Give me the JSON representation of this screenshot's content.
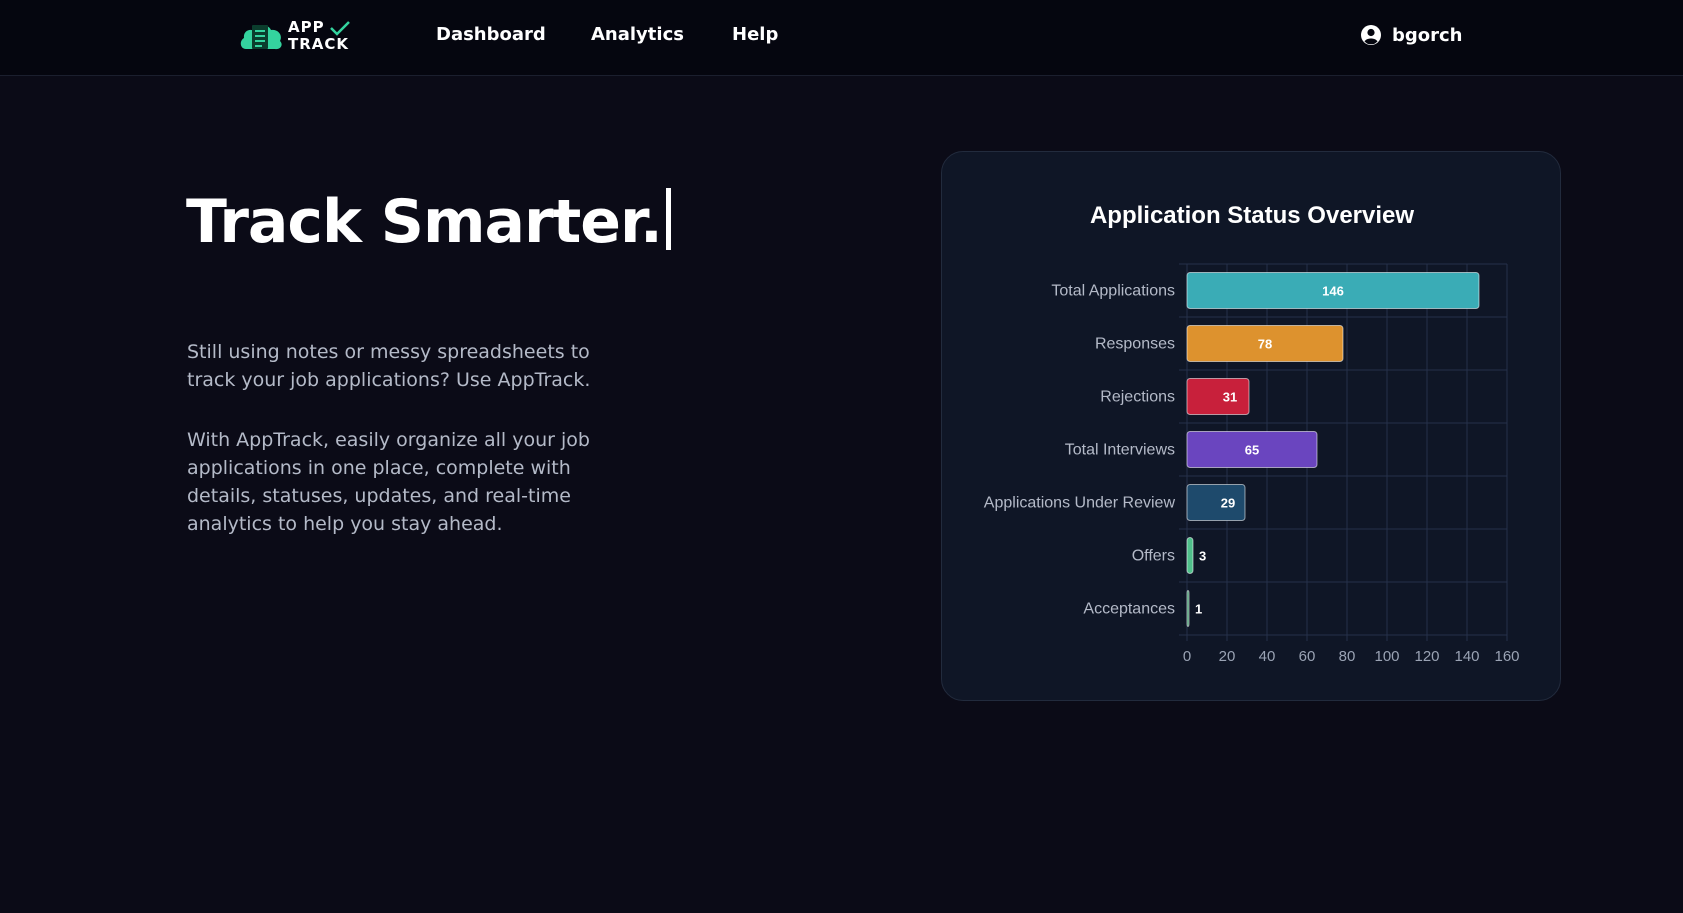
{
  "app": {
    "logo_line1": "APP",
    "logo_line2": "TRACK",
    "accent_color": "#34d39e"
  },
  "nav": {
    "items": [
      {
        "label": "Dashboard"
      },
      {
        "label": "Analytics"
      },
      {
        "label": "Help"
      }
    ],
    "user": {
      "name": "bgorch",
      "icon": "user-circle-icon"
    }
  },
  "hero": {
    "headline": "Track Smarter.",
    "paragraph1": "Still using notes or messy spreadsheets to track your job applications? Use AppTrack.",
    "paragraph2": "With AppTrack, easily organize all your job applications in one place, complete with details, statuses, updates, and real-time analytics to help you stay ahead."
  },
  "chart_data": {
    "type": "bar",
    "orientation": "horizontal",
    "title": "Application Status Overview",
    "categories": [
      "Total Applications",
      "Responses",
      "Rejections",
      "Total Interviews",
      "Applications Under Review",
      "Offers",
      "Acceptances"
    ],
    "values": [
      146,
      78,
      31,
      65,
      29,
      3,
      1
    ],
    "colors": [
      "#3aacb6",
      "#dd922e",
      "#c8203b",
      "#6a45bf",
      "#1e4a6c",
      "#4fbf8a",
      "#3d8f67"
    ],
    "xlim": [
      0,
      160
    ],
    "xticks": [
      0,
      20,
      40,
      60,
      80,
      100,
      120,
      140,
      160
    ],
    "grid": true,
    "data_labels": true
  }
}
